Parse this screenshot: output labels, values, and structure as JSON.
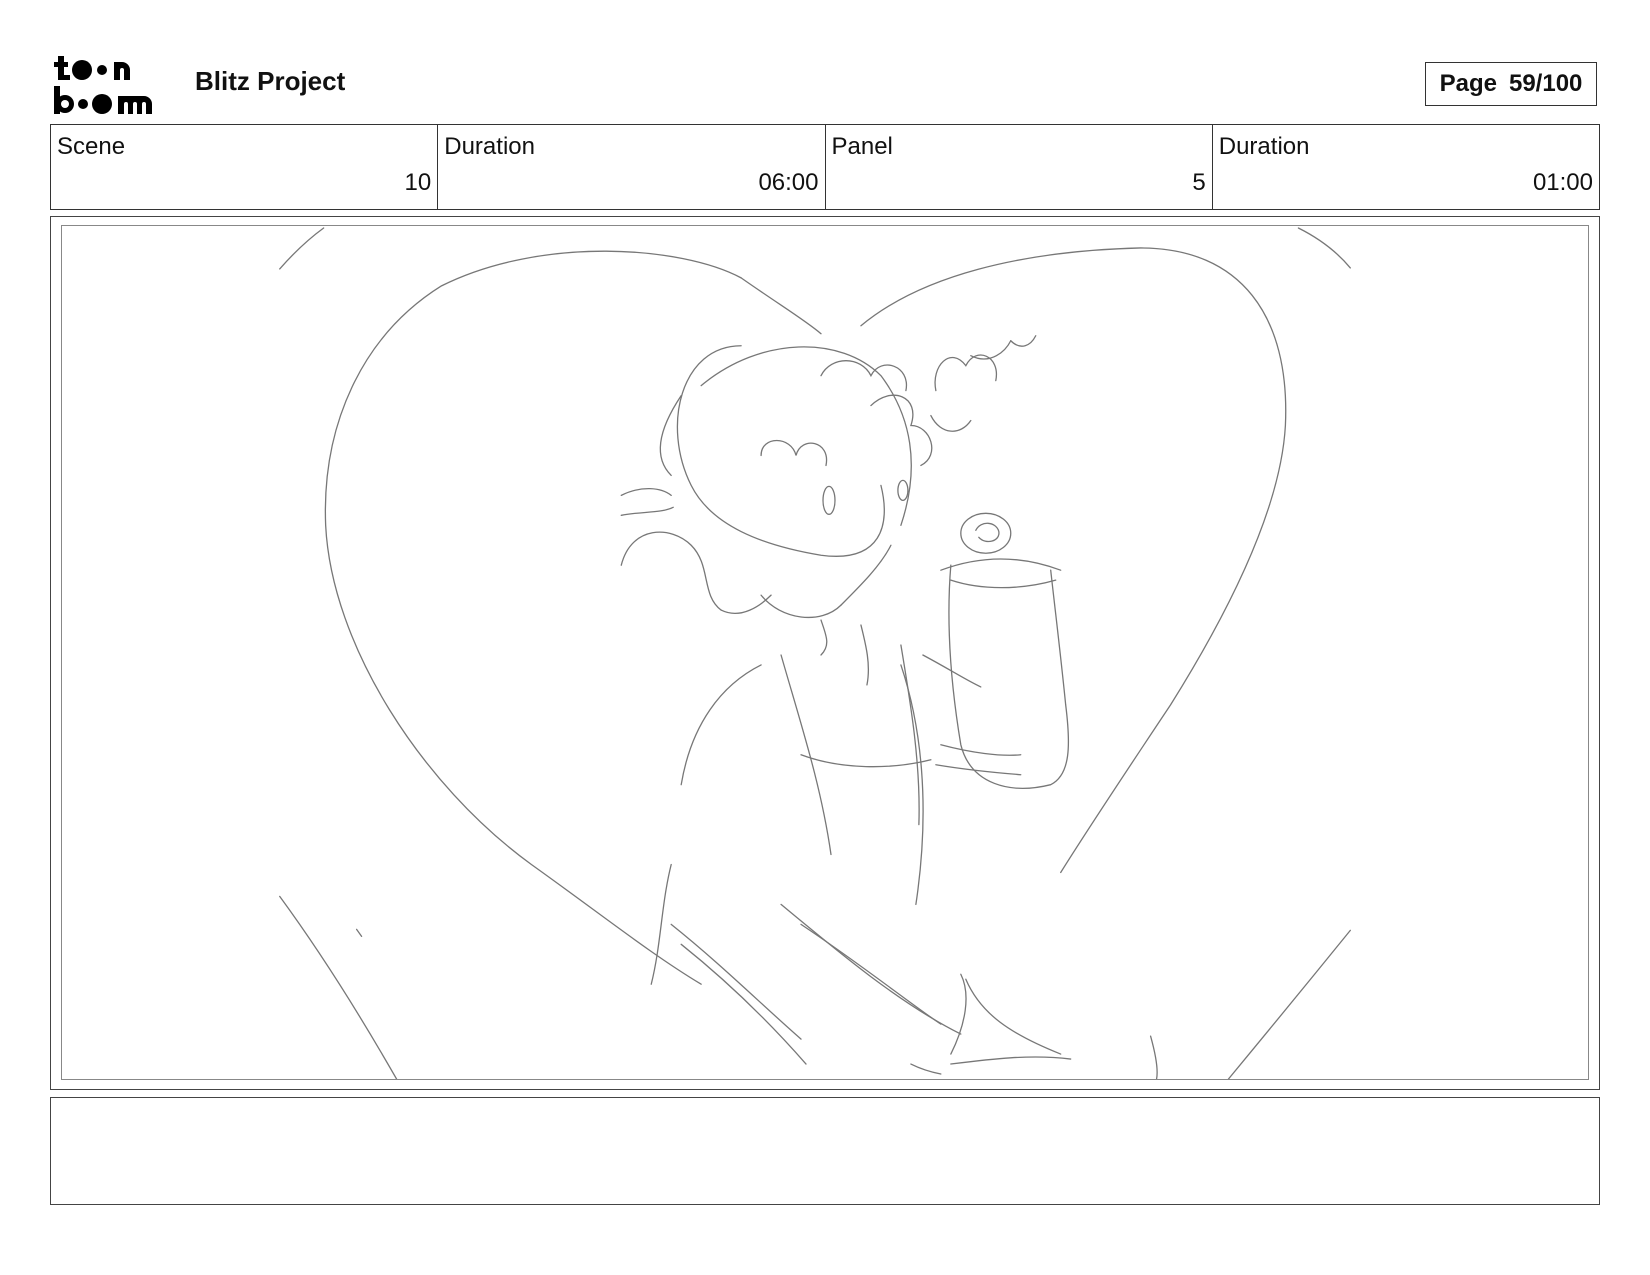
{
  "header": {
    "logo_text": "toon boom",
    "project_title": "Blitz Project",
    "page_label": "Page",
    "page_value": "59/100"
  },
  "info": {
    "scene_label": "Scene",
    "scene_value": "10",
    "scene_duration_label": "Duration",
    "scene_duration_value": "06:00",
    "panel_label": "Panel",
    "panel_value": "5",
    "panel_duration_label": "Duration",
    "panel_duration_value": "01:00"
  },
  "panel": {
    "drawing_icon": "pencil-sketch-heart-character"
  },
  "notes": {
    "text": ""
  }
}
